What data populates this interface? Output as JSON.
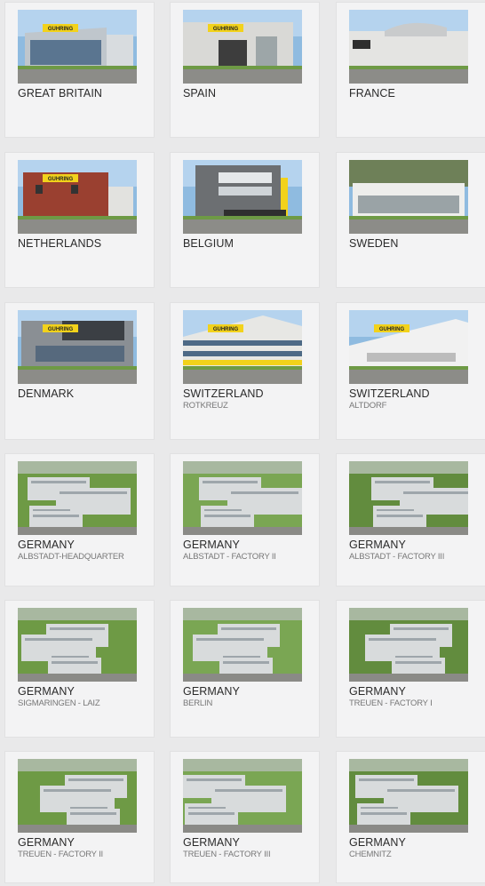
{
  "locations": [
    {
      "country": "GREAT BRITAIN",
      "sub": ""
    },
    {
      "country": "SPAIN",
      "sub": ""
    },
    {
      "country": "FRANCE",
      "sub": ""
    },
    {
      "country": "NETHERLANDS",
      "sub": ""
    },
    {
      "country": "BELGIUM",
      "sub": ""
    },
    {
      "country": "SWEDEN",
      "sub": ""
    },
    {
      "country": "DENMARK",
      "sub": ""
    },
    {
      "country": "SWITZERLAND",
      "sub": "ROTKREUZ"
    },
    {
      "country": "SWITZERLAND",
      "sub": "ALTDORF"
    },
    {
      "country": "GERMANY",
      "sub": "ALBSTADT-HEADQUARTER"
    },
    {
      "country": "GERMANY",
      "sub": "ALBSTADT - FACTORY II"
    },
    {
      "country": "GERMANY",
      "sub": "ALBSTADT - FACTORY III"
    },
    {
      "country": "GERMANY",
      "sub": "SIGMARINGEN - LAIZ"
    },
    {
      "country": "GERMANY",
      "sub": "BERLIN"
    },
    {
      "country": "GERMANY",
      "sub": "TREUEN - FACTORY I"
    },
    {
      "country": "GERMANY",
      "sub": "TREUEN - FACTORY II"
    },
    {
      "country": "GERMANY",
      "sub": "TREUEN - FACTORY III"
    },
    {
      "country": "GERMANY",
      "sub": "CHEMNITZ"
    }
  ],
  "photo_signs": [
    "GUHRING",
    "GUHRING",
    "",
    "GUHRING",
    "",
    "",
    "GUHRING",
    "GUHRING",
    "GUHRING",
    "",
    "",
    "",
    "",
    "",
    "",
    "",
    "",
    ""
  ],
  "colors": {
    "background": "#e9e9ea",
    "card": "#f3f3f4",
    "country_text": "#2a2a2a",
    "location_text": "#777777",
    "brand_yellow": "#f2d21b",
    "sky": "#8fbbe0",
    "grass": "#6e9a45"
  }
}
